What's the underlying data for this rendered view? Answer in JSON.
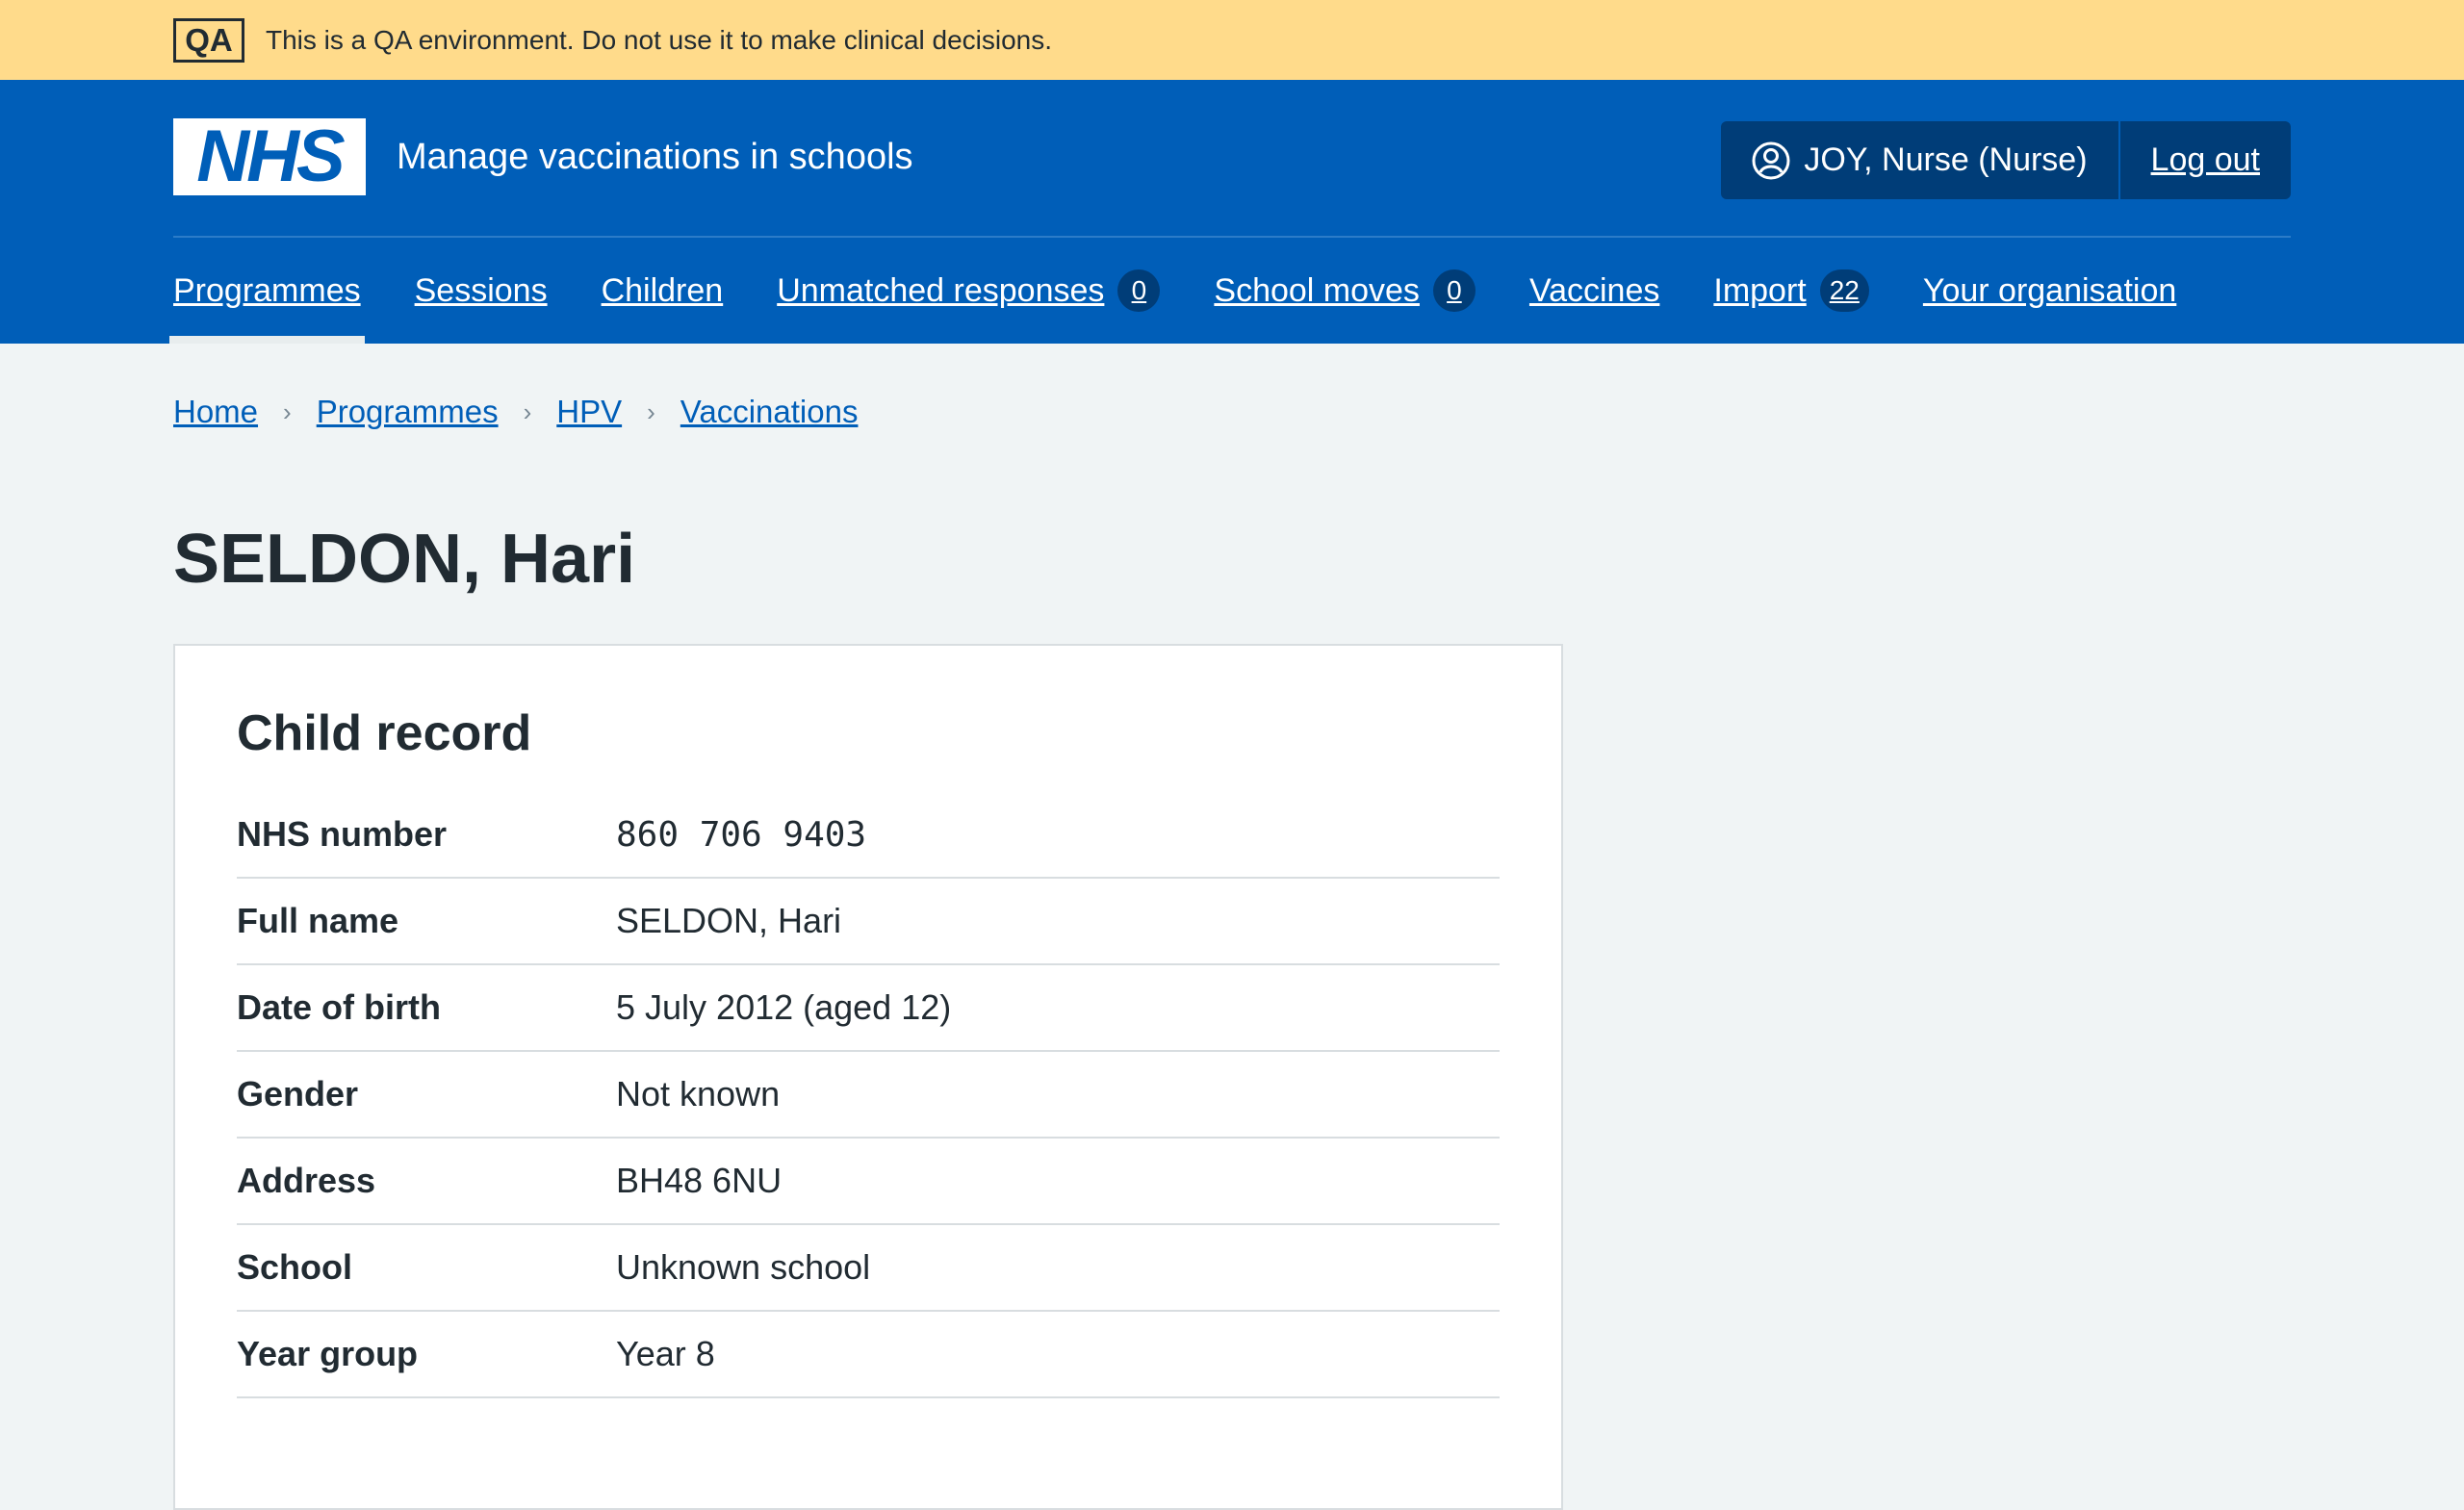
{
  "qa_banner": {
    "tag": "QA",
    "text": "This is a QA environment. Do not use it to make clinical decisions."
  },
  "header": {
    "logo_text": "NHS",
    "service_name": "Manage vaccinations in schools",
    "user": "JOY, Nurse (Nurse)",
    "logout": "Log out"
  },
  "nav": {
    "items": [
      {
        "label": "Programmes"
      },
      {
        "label": "Sessions"
      },
      {
        "label": "Children"
      },
      {
        "label": "Unmatched responses",
        "count": "0"
      },
      {
        "label": "School moves",
        "count": "0"
      },
      {
        "label": "Vaccines"
      },
      {
        "label": "Import",
        "count": "22"
      },
      {
        "label": "Your organisation"
      }
    ]
  },
  "breadcrumb": [
    "Home",
    "Programmes",
    "HPV",
    "Vaccinations"
  ],
  "page_title": "SELDON, Hari",
  "card": {
    "title": "Child record",
    "rows": [
      {
        "key": "NHS number",
        "value": "860 706 9403"
      },
      {
        "key": "Full name",
        "value": "SELDON, Hari"
      },
      {
        "key": "Date of birth",
        "value": "5 July 2012 (aged 12)"
      },
      {
        "key": "Gender",
        "value": "Not known"
      },
      {
        "key": "Address",
        "value": "BH48 6NU"
      },
      {
        "key": "School",
        "value": "Unknown school"
      },
      {
        "key": "Year group",
        "value": "Year 8"
      }
    ]
  }
}
